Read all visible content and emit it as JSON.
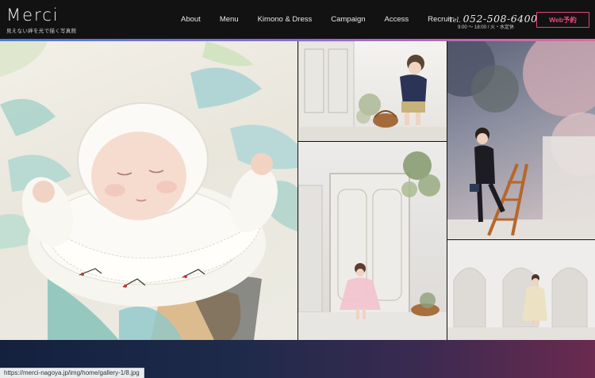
{
  "header": {
    "logo": "Merci",
    "tagline": "見えない絆を光で描く写真館",
    "nav": [
      "About",
      "Menu",
      "Kimono & Dress",
      "Campaign",
      "Access",
      "Recruit"
    ],
    "tel_prefix": "Tel.",
    "tel_number": "052-508-6400",
    "hours": "9:00 〜 18:00 / 火・水定休",
    "web_button": "Web予約"
  },
  "gallery": {
    "tiles": [
      {
        "subject": "sleeping baby in bonnet"
      },
      {
        "subject": "child with basket by cabinet"
      },
      {
        "subject": "girl in pink tutu by wardrobe"
      },
      {
        "subject": "boy on ladder"
      },
      {
        "subject": "girl in dress under arches"
      }
    ]
  },
  "status_url": "https://merci-nagoya.jp/img/home/gallery-1/8.jpg",
  "colors": {
    "accent": "#e0457c",
    "header_bg": "#121212"
  }
}
